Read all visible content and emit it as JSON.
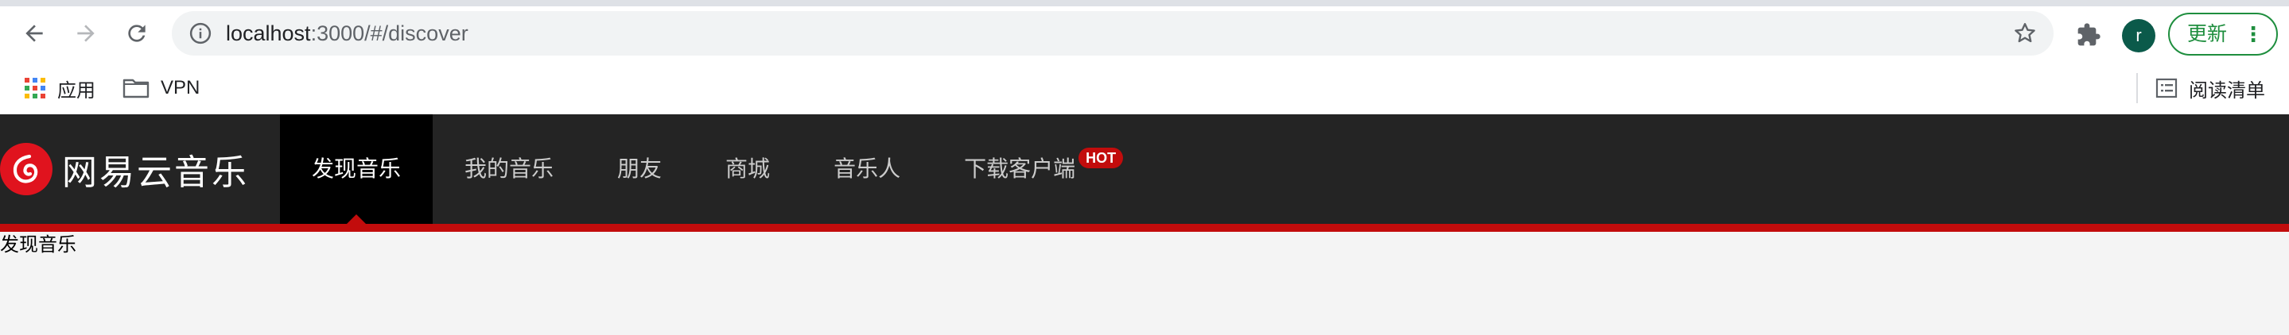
{
  "browser": {
    "url_host": "localhost",
    "url_rest": ":3000/#/discover",
    "avatar_letter": "r",
    "update_label": "更新",
    "bookmarks": {
      "apps": "应用",
      "vpn": "VPN",
      "reading_list": "阅读清单"
    }
  },
  "site": {
    "logo_text": "网易云音乐",
    "nav": [
      {
        "label": "发现音乐",
        "active": true
      },
      {
        "label": "我的音乐"
      },
      {
        "label": "朋友"
      },
      {
        "label": "商城"
      },
      {
        "label": "音乐人"
      },
      {
        "label": "下载客户端",
        "badge": "HOT"
      }
    ]
  },
  "content": {
    "text": "发现音乐"
  },
  "colors": {
    "brand_red": "#c20c0c",
    "topbar_bg": "#242424",
    "update_green": "#1e8e3e"
  }
}
